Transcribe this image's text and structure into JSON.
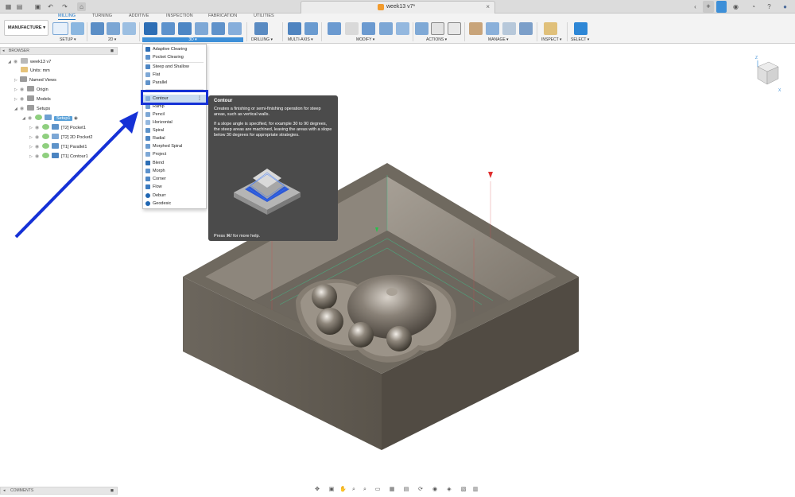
{
  "titlebar": {
    "document_title": "week13 v7*",
    "icons": [
      "app-menu-icon",
      "file-icon",
      "save-icon",
      "undo-icon",
      "redo-icon",
      "home-icon"
    ]
  },
  "toolbar": {
    "workspace": "MANUFACTURE",
    "tabs": [
      {
        "label": "MILLING",
        "active": true
      },
      {
        "label": "TURNING",
        "active": false
      },
      {
        "label": "ADDITIVE",
        "active": false
      },
      {
        "label": "INSPECTION",
        "active": false
      },
      {
        "label": "FABRICATION",
        "active": false
      },
      {
        "label": "UTILITIES",
        "active": false
      }
    ],
    "groups": {
      "setup": "SETUP ▾",
      "two_d": "2D ▾",
      "three_d": "3D ▾",
      "drilling": "DRILLING ▾",
      "multi_axis": "MULTI-AXIS ▾",
      "modify": "MODIFY ▾",
      "actions": "ACTIONS ▾",
      "manage": "MANAGE ▾",
      "inspect": "INSPECT ▾",
      "select": "SELECT ▾"
    }
  },
  "browser": {
    "header": "BROWSER",
    "items": [
      {
        "label": "week13 v7"
      },
      {
        "label": "Units: mm"
      },
      {
        "label": "Named Views"
      },
      {
        "label": "Origin"
      },
      {
        "label": "Models"
      },
      {
        "label": "Setups"
      },
      {
        "label": "Setup1"
      },
      {
        "label": "[T2] Pocket1"
      },
      {
        "label": "[T2] 2D Pocket2"
      },
      {
        "label": "[T1] Parallel1"
      },
      {
        "label": "[T1] Contour1"
      }
    ]
  },
  "menu_3d": {
    "items": [
      "Adaptive Clearing",
      "Pocket Clearing",
      "Steep and Shallow",
      "Flat",
      "Parallel",
      "Contour",
      "Ramp",
      "Pencil",
      "Horizontal",
      "Spiral",
      "Radial",
      "Morphed Spiral",
      "Project",
      "Blend",
      "Morph",
      "Corner",
      "Flow",
      "Deburr",
      "Geodesic"
    ],
    "more_glyph": "⋮"
  },
  "tooltip": {
    "title": "Contour",
    "paragraph1": "Creates a finishing or semi-finishing operation for steep areas, such as vertical walls.",
    "paragraph2": "If a slope angle is specified, for example 30 to 90 degrees, the steep areas are machined, leaving the areas with a slope below 30 degrees for appropriate strategies.",
    "footer": "Press ⌘/ for more help."
  },
  "bottom": {
    "comments": "COMMENTS"
  },
  "colors": {
    "accent": "#1a73c4",
    "highlight": "#1531d6",
    "tooltip_bg": "#4b4b4b",
    "model": "#6a645c"
  }
}
